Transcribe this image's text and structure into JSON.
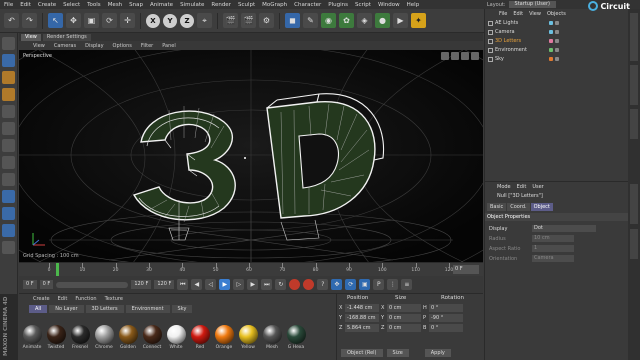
{
  "menubar": {
    "items": [
      "File",
      "Edit",
      "Create",
      "Select",
      "Tools",
      "Mesh",
      "Snap",
      "Animate",
      "Simulate",
      "Render",
      "Sculpt",
      "MoGraph",
      "Character",
      "Plugins",
      "Script",
      "Window",
      "Help"
    ],
    "layout_label": "Layout:",
    "layout_value": "Startup (User)"
  },
  "toolbar": {
    "axis_x": "X",
    "axis_y": "Y",
    "axis_z": "Z"
  },
  "viewport": {
    "tabs": [
      "View",
      "Render Settings"
    ],
    "menu": [
      "View",
      "Cameras",
      "Display",
      "Options",
      "Filter",
      "Panel"
    ],
    "label": "Perspective",
    "grid_spacing": "Grid Spacing : 100 cm",
    "text_3d": "3D"
  },
  "timeline": {
    "ticks": [
      "0",
      "10",
      "20",
      "30",
      "40",
      "50",
      "60",
      "70",
      "80",
      "90",
      "100",
      "110",
      "120"
    ],
    "frame_end": "0 F",
    "current_frame": 2
  },
  "transport": {
    "start": "0 F",
    "current": "0 F",
    "end": "120 F",
    "end2": "120 F"
  },
  "materials": {
    "menu": [
      "Create",
      "Edit",
      "Function",
      "Texture"
    ],
    "filters": [
      "All",
      "No Layer",
      "3D Letters",
      "Environment",
      "Sky"
    ],
    "selected_filter": "All",
    "swatches": [
      {
        "label": "Animate",
        "color": "#5a5a5a"
      },
      {
        "label": "Twisted",
        "color": "#3a2418"
      },
      {
        "label": "Fresnel",
        "color": "#2a2a2a"
      },
      {
        "label": "Chrome",
        "color": "#a0a0a0"
      },
      {
        "label": "Golden",
        "color": "#8a5a1a"
      },
      {
        "label": "Connect",
        "color": "#4a2a1a"
      },
      {
        "label": "White",
        "color": "#f0f0f0"
      },
      {
        "label": "Red",
        "color": "#d01a10"
      },
      {
        "label": "Orange",
        "color": "#f07a10"
      },
      {
        "label": "Yellow",
        "color": "#e8c020"
      },
      {
        "label": "Mesh",
        "color": "#555555"
      },
      {
        "label": "G Hexa",
        "color": "#2a4a3a"
      }
    ],
    "brand": "MAXON CINEMA 4D"
  },
  "coords": {
    "headers": {
      "position": "Position",
      "size": "Size",
      "rotation": "Rotation"
    },
    "rows": [
      {
        "axis": "X",
        "pos": "-1.448 cm",
        "size": "0 cm",
        "rot_axis": "H",
        "rot": "0 °"
      },
      {
        "axis": "Y",
        "pos": "-168.88 cm",
        "size": "0 cm",
        "rot_axis": "P",
        "rot": "-90 °"
      },
      {
        "axis": "Z",
        "pos": "5.864 cm",
        "size": "0 cm",
        "rot_axis": "B",
        "rot": "0 °"
      }
    ],
    "mode": "Object (Rel)",
    "size_mode": "Size",
    "apply": "Apply"
  },
  "objects": {
    "menu": [
      "File",
      "Edit",
      "View",
      "Objects"
    ],
    "items": [
      {
        "name": "AE Lights",
        "highlight": false,
        "tag": "#6cc0e0"
      },
      {
        "name": "Camera",
        "highlight": false,
        "tag": "#6cc0e0"
      },
      {
        "name": "3D Letters",
        "highlight": true,
        "tag": "#e07aa0"
      },
      {
        "name": "Environment",
        "highlight": false,
        "tag": "#6cc070"
      },
      {
        "name": "Sky",
        "highlight": false,
        "tag": "#e07a30"
      }
    ],
    "logo_text": "Circuit"
  },
  "attributes": {
    "menu": [
      "Mode",
      "Edit",
      "User"
    ],
    "title": "Null [\"3D Letters\"]",
    "tabs": [
      "Basic",
      "Coord.",
      "Object"
    ],
    "selected_tab": "Object",
    "section": "Object Properties",
    "rows": [
      {
        "label": "Display",
        "value": "Dot",
        "dim": false
      },
      {
        "label": "Radius",
        "value": "10 cm",
        "dim": true
      },
      {
        "label": "Aspect Ratio",
        "value": "1",
        "dim": true
      },
      {
        "label": "Orientation",
        "value": "Camera",
        "dim": true
      }
    ]
  }
}
